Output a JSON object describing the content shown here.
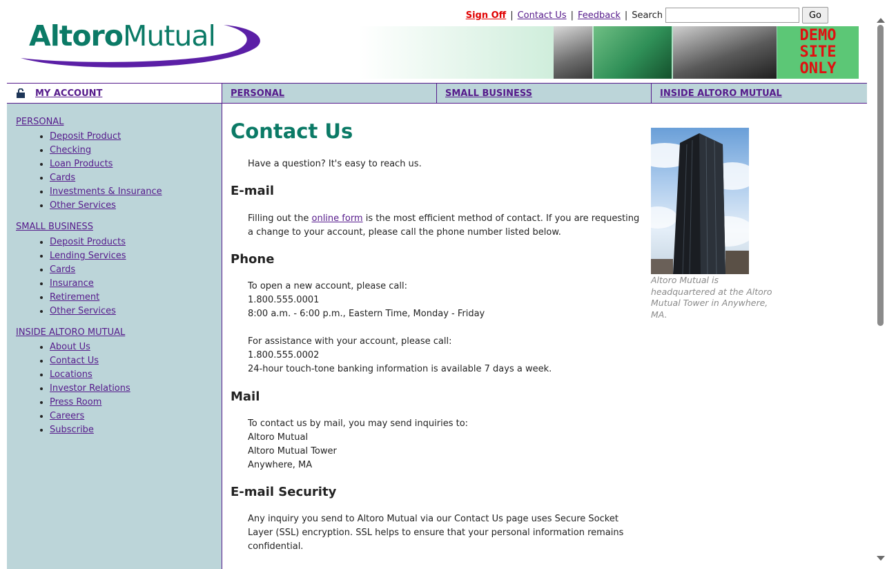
{
  "brand": {
    "logo_bold": "Altoro",
    "logo_regular": "Mutual"
  },
  "top_links": {
    "sign_off": "Sign Off",
    "contact_us": "Contact Us",
    "feedback": "Feedback",
    "search_label": "Search",
    "search_value": "",
    "go_label": "Go"
  },
  "banner": {
    "demo_line1": "DEMO",
    "demo_line2": "SITE",
    "demo_line3": "ONLY"
  },
  "nav": {
    "my_account": "MY ACCOUNT",
    "tabs": [
      "PERSONAL",
      "SMALL BUSINESS",
      "INSIDE ALTORO MUTUAL"
    ]
  },
  "sidebar": {
    "sections": [
      {
        "title": "PERSONAL",
        "items": [
          "Deposit Product",
          "Checking",
          "Loan Products",
          "Cards",
          "Investments & Insurance",
          "Other Services"
        ]
      },
      {
        "title": "SMALL BUSINESS",
        "items": [
          "Deposit Products",
          "Lending Services",
          "Cards",
          "Insurance",
          "Retirement",
          "Other Services"
        ]
      },
      {
        "title": "INSIDE ALTORO MUTUAL",
        "items": [
          "About Us",
          "Contact Us",
          "Locations",
          "Investor Relations",
          "Press Room",
          "Careers",
          "Subscribe"
        ]
      }
    ]
  },
  "content": {
    "title": "Contact Us",
    "intro": "Have a question? It's easy to reach us.",
    "email": {
      "heading": "E-mail",
      "text_before": "Filling out the ",
      "link": "online form",
      "text_after": " is the most efficient method of contact. If you are requesting a change to your account, please call the phone number listed below."
    },
    "phone": {
      "heading": "Phone",
      "new_account_label": "To open a new account, please call:",
      "new_account_number": "1.800.555.0001",
      "new_account_hours": "8:00 a.m. - 6:00 p.m., Eastern Time, Monday - Friday",
      "assistance_label": "For assistance with your account, please call:",
      "assistance_number": "1.800.555.0002",
      "assistance_hours": "24-hour touch-tone banking information is available 7 days a week."
    },
    "mail": {
      "heading": "Mail",
      "intro": "To contact us by mail, you may send inquiries to:",
      "line1": "Altoro Mutual",
      "line2": "Altoro Mutual Tower",
      "line3": "Anywhere, MA"
    },
    "security": {
      "heading": "E-mail Security",
      "text": "Any inquiry you send to Altoro Mutual via our Contact Us page uses Secure Socket Layer (SSL) encryption. SSL helps to ensure that your personal information remains confidential."
    },
    "caption": "Altoro Mutual is headquartered at the Altoro Mutual Tower in Anywhere, MA."
  },
  "colors": {
    "brand_green": "#0b7a66",
    "nav_bg": "#bcd5d9",
    "link": "#551a8b",
    "sign_off": "#e00000"
  }
}
